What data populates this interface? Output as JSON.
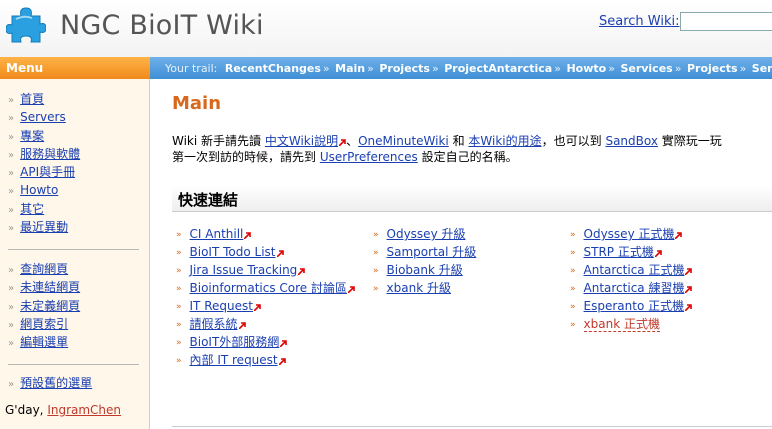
{
  "header": {
    "site_title": "NGC BioIT Wiki",
    "search_label": "Search Wiki:",
    "search_value": ""
  },
  "menu": {
    "title": "Menu"
  },
  "trail": {
    "label": "Your trail:",
    "items": [
      "RecentChanges",
      "Main",
      "Projects",
      "ProjectAntarctica",
      "Howto",
      "Services",
      "Projects",
      "Servers"
    ]
  },
  "sidebar": {
    "group1": [
      "首頁",
      "Servers",
      "專案",
      "服務與軟體",
      "API與手冊",
      "Howto",
      "其它",
      "最近異動"
    ],
    "group2": [
      "查詢網頁",
      "未連結網頁",
      "未定義網頁",
      "網頁索引",
      "編輯選單"
    ],
    "group3": [
      "預設舊的選單"
    ],
    "greeting": "G'day,",
    "user": "IngramChen"
  },
  "main": {
    "title": "Main",
    "intro": {
      "t1": "Wiki 新手請先讀 ",
      "l1": "中文Wiki說明",
      "t2": "、",
      "l2": "OneMinuteWiki",
      "t3": " 和 ",
      "l3": "本Wiki的用途",
      "t4": "，也可以到 ",
      "l4": "SandBox",
      "t5": " 實際玩一玩",
      "t6": "第一次到訪的時候，請先到 ",
      "l5": "UserPreferences",
      "t7": " 設定自己的名稱。"
    },
    "quick_links_title": "快速連結",
    "col1": [
      {
        "label": "CI Anthill",
        "ext": true
      },
      {
        "label": "BioIT Todo List",
        "ext": true
      },
      {
        "label": "Jira Issue Tracking",
        "ext": true
      },
      {
        "label": "Bioinformatics Core 討論區",
        "ext": true
      },
      {
        "label": "IT Request",
        "ext": true
      },
      {
        "label": "請假系統",
        "ext": true
      },
      {
        "label": "BioIT外部服務網",
        "ext": true
      },
      {
        "label": "內部 IT request",
        "ext": true
      }
    ],
    "col2": [
      {
        "label": "Odyssey 升級"
      },
      {
        "label": "Samportal 升級"
      },
      {
        "label": "Biobank 升級"
      },
      {
        "label": "xbank 升級"
      }
    ],
    "col3": [
      {
        "label": "Odyssey 正式機",
        "ext": true
      },
      {
        "label": "STRP 正式機",
        "ext": true
      },
      {
        "label": "Antarctica 正式機",
        "ext": true
      },
      {
        "label": "Antarctica 練習機",
        "ext": true
      },
      {
        "label": "Esperanto 正式機",
        "ext": true
      },
      {
        "label": "xbank 正式機",
        "missing": true
      }
    ]
  }
}
